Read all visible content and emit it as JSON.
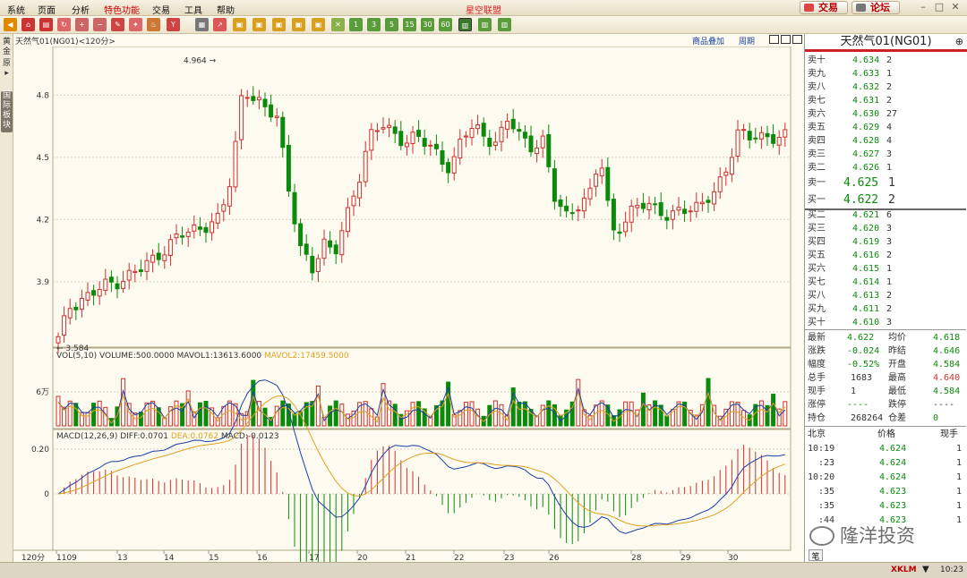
{
  "menu": [
    "系统",
    "页面",
    "分析",
    "特色功能",
    "交易",
    "工具",
    "帮助"
  ],
  "app_title": "星空联盟",
  "top_buttons": {
    "trade": "交易",
    "forum": "论坛"
  },
  "toolbar_labels": [
    "1",
    "3",
    "5",
    "15",
    "30",
    "60"
  ],
  "side_tabs": [
    "黄金",
    "原▸",
    "国际板块"
  ],
  "chart_header": {
    "title": "天然气01(NG01)<120分>",
    "k_label": "K",
    "btn_overlay": "商品叠加",
    "btn_period": "周期"
  },
  "price_axis": [
    "4.8",
    "4.5",
    "4.2",
    "3.9"
  ],
  "annotations": {
    "high": "4.964",
    "low": "3.584"
  },
  "vol_header": {
    "main": "VOL(5,10) VOLUME:500.0000 MAVOL1:13613.6000",
    "mavol2": "MAVOL2:17459.5000"
  },
  "vol_axis": "6万",
  "macd_header": {
    "main": "MACD(12,26,9) DIFF:0.0701",
    "dea": "DEA:0.0762",
    "macd": "MACD:-0.0123"
  },
  "macd_axis": [
    "0.20",
    "0"
  ],
  "x_axis": {
    "period": "120分",
    "dates": [
      "1109",
      "13",
      "14",
      "15",
      "16",
      "17",
      "20",
      "21",
      "22",
      "23",
      "26",
      "28",
      "29",
      "30"
    ]
  },
  "chart_data": {
    "type": "candlestick",
    "title": "天然气01(NG01)<120分>",
    "ylim": [
      3.55,
      5.0
    ],
    "y_ticks": [
      4.8,
      4.5,
      4.2,
      3.9
    ],
    "labeled_high": 4.964,
    "labeled_low": 3.584,
    "last_price": 4.622,
    "approx_close_path": [
      3.62,
      3.78,
      3.82,
      3.84,
      3.88,
      3.9,
      3.93,
      3.95,
      4.0,
      4.05,
      4.1,
      4.13,
      4.16,
      4.18,
      4.2,
      4.4,
      4.85,
      4.78,
      4.72,
      4.7,
      4.35,
      4.05,
      3.95,
      4.1,
      4.05,
      4.2,
      4.38,
      4.62,
      4.66,
      4.6,
      4.58,
      4.62,
      4.55,
      4.5,
      4.45,
      4.6,
      4.64,
      4.6,
      4.58,
      4.68,
      4.6,
      4.56,
      4.58,
      4.3,
      4.22,
      4.28,
      4.3,
      4.5,
      4.15,
      4.18,
      4.25,
      4.28,
      4.26,
      4.2,
      4.24,
      4.26,
      4.3,
      4.32,
      4.45,
      4.65,
      4.6,
      4.58,
      4.6,
      4.62
    ]
  },
  "quote_panel": {
    "title": "天然气01(NG01)",
    "asks": [
      {
        "label": "卖十",
        "price": "4.634",
        "qty": "2"
      },
      {
        "label": "卖九",
        "price": "4.633",
        "qty": "1"
      },
      {
        "label": "卖八",
        "price": "4.632",
        "qty": "2"
      },
      {
        "label": "卖七",
        "price": "4.631",
        "qty": "2"
      },
      {
        "label": "卖六",
        "price": "4.630",
        "qty": "27"
      },
      {
        "label": "卖五",
        "price": "4.629",
        "qty": "4"
      },
      {
        "label": "卖四",
        "price": "4.628",
        "qty": "4"
      },
      {
        "label": "卖三",
        "price": "4.627",
        "qty": "3"
      },
      {
        "label": "卖二",
        "price": "4.626",
        "qty": "1"
      },
      {
        "label": "卖一",
        "price": "4.625",
        "qty": "1"
      }
    ],
    "bids": [
      {
        "label": "买一",
        "price": "4.622",
        "qty": "2"
      },
      {
        "label": "买二",
        "price": "4.621",
        "qty": "6"
      },
      {
        "label": "买三",
        "price": "4.620",
        "qty": "3"
      },
      {
        "label": "买四",
        "price": "4.619",
        "qty": "3"
      },
      {
        "label": "买五",
        "price": "4.616",
        "qty": "2"
      },
      {
        "label": "买六",
        "price": "4.615",
        "qty": "1"
      },
      {
        "label": "买七",
        "price": "4.614",
        "qty": "1"
      },
      {
        "label": "买八",
        "price": "4.613",
        "qty": "2"
      },
      {
        "label": "买九",
        "price": "4.611",
        "qty": "2"
      },
      {
        "label": "买十",
        "price": "4.610",
        "qty": "3"
      }
    ],
    "stats": [
      {
        "l1": "最新",
        "v1": "4.622",
        "l2": "均价",
        "v2": "4.618"
      },
      {
        "l1": "涨跌",
        "v1": "-0.024",
        "l2": "昨结",
        "v2": "4.646"
      },
      {
        "l1": "幅度",
        "v1": "-0.52%",
        "l2": "开盘",
        "v2": "4.584"
      },
      {
        "l1": "总手",
        "v1": "1683",
        "l2": "最高",
        "v2": "4.640"
      },
      {
        "l1": "现手",
        "v1": "1",
        "l2": "最低",
        "v2": "4.584"
      },
      {
        "l1": "涨停",
        "v1": "----",
        "l2": "跌停",
        "v2": "----"
      },
      {
        "l1": "持仓",
        "v1": "268264",
        "l2": "仓差",
        "v2": "0"
      }
    ],
    "ticks_header": {
      "c1": "北京",
      "c2": "价格",
      "c3": "现手"
    },
    "ticks": [
      {
        "time": "10:19",
        "price": "4.624",
        "qty": "1"
      },
      {
        "time": ":23",
        "price": "4.624",
        "qty": "1"
      },
      {
        "time": "10:20",
        "price": "4.624",
        "qty": "1"
      },
      {
        "time": ":35",
        "price": "4.623",
        "qty": "1"
      },
      {
        "time": ":35",
        "price": "4.623",
        "qty": "1"
      },
      {
        "time": ":44",
        "price": "4.623",
        "qty": "1"
      }
    ],
    "bottom_tab": "笔"
  },
  "watermark": "隆洋投资",
  "status": {
    "brand": "XKLM",
    "time": "10:23"
  },
  "colors": {
    "up": "#d03030",
    "down": "#0b8a0b",
    "ma1": "#1a3fa8",
    "ma2": "#e0a020",
    "panel_bg": "#fdfbf0"
  }
}
